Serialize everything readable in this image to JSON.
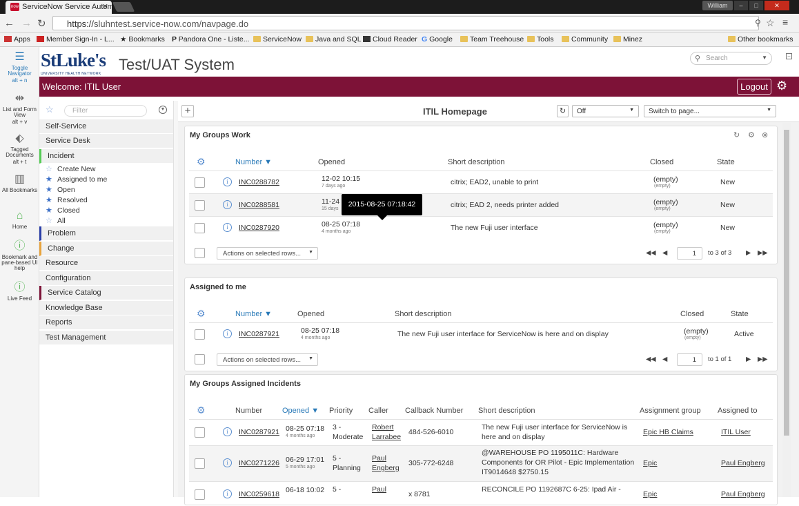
{
  "browser": {
    "tab_title": "ServiceNow Service Autom",
    "tab_favicon": "now",
    "user_badge": "William",
    "url_scheme": "https://",
    "url_rest": "sluhntest.service-now.com/navpage.do",
    "bookmarks": [
      "Apps",
      "Member Sign-In - L...",
      "Bookmarks",
      "Pandora One - Liste...",
      "ServiceNow",
      "Java and SQL",
      "Cloud Reader",
      "Google",
      "Team Treehouse",
      "Tools",
      "Community",
      "Minez"
    ],
    "other_bookmarks": "Other bookmarks"
  },
  "rail": {
    "items": [
      {
        "label": "Toggle Navigator",
        "shortcut": "alt + n"
      },
      {
        "label": "List and Form View",
        "shortcut": "alt + v"
      },
      {
        "label": "Tagged Documents",
        "shortcut": "alt + t"
      },
      {
        "label": "All Bookmarks",
        "shortcut": ""
      },
      {
        "label": "Home",
        "shortcut": ""
      },
      {
        "label": "Bookmark and pane-based UI help",
        "shortcut": ""
      },
      {
        "label": "Live Feed",
        "shortcut": ""
      }
    ]
  },
  "header": {
    "logo": "StLuke's",
    "logo_sub": "UNIVERSITY HEALTH NETWORK",
    "system_title": "Test/UAT System",
    "search_placeholder": "Search",
    "welcome": "Welcome:  ITIL User",
    "logout": "Logout"
  },
  "nav": {
    "filter_placeholder": "Filter",
    "modules": [
      "Self-Service",
      "Service Desk",
      "Incident",
      "Problem",
      "Change",
      "Resource",
      "Configuration",
      "Service Catalog",
      "Knowledge Base",
      "Reports",
      "Test Management"
    ],
    "incident_links": [
      "Create New",
      "Assigned to me",
      "Open",
      "Resolved",
      "Closed",
      "All"
    ]
  },
  "content": {
    "title": "ITIL Homepage",
    "off_select": "Off",
    "switch_page": "Switch to page...",
    "tooltip": "2015-08-25 07:18:42"
  },
  "panel1": {
    "title": "My Groups Work",
    "headers": [
      "Number ▼",
      "Opened",
      "Short description",
      "Closed",
      "State"
    ],
    "rows": [
      {
        "number": "INC0288782",
        "opened": "12-02 10:15",
        "ago": "7 days ago",
        "desc": "citrix; EAD2, unable to print",
        "closed": "(empty)",
        "closed_sub": "(empty)",
        "state": "New"
      },
      {
        "number": "INC0288581",
        "opened": "11-24",
        "ago": "15 days",
        "desc": "citrix; EAD 2, needs printer added",
        "closed": "(empty)",
        "closed_sub": "(empty)",
        "state": "New"
      },
      {
        "number": "INC0287920",
        "opened": "08-25 07:18",
        "ago": "4 months ago",
        "desc": "The new Fuji user interface",
        "closed": "(empty)",
        "closed_sub": "(empty)",
        "state": "New"
      }
    ],
    "actions": "Actions on selected rows...",
    "page": "1",
    "page_of": "to 3 of 3"
  },
  "panel2": {
    "title": "Assigned to me",
    "headers": [
      "Number ▼",
      "Opened",
      "Short description",
      "Closed",
      "State"
    ],
    "rows": [
      {
        "number": "INC0287921",
        "opened": "08-25 07:18",
        "ago": "4 months ago",
        "desc": "The new Fuji user interface for ServiceNow is here and on display",
        "closed": "(empty)",
        "closed_sub": "(empty)",
        "state": "Active"
      }
    ],
    "actions": "Actions on selected rows...",
    "page": "1",
    "page_of": "to 1 of 1"
  },
  "panel3": {
    "title": "My Groups Assigned Incidents",
    "headers": [
      "Number",
      "Opened ▼",
      "Priority",
      "Caller",
      "Callback Number",
      "Short description",
      "Assignment group",
      "Assigned to"
    ],
    "rows": [
      {
        "number": "INC0287921",
        "opened": "08-25 07:18",
        "ago": "4 months ago",
        "priority1": "3 -",
        "priority2": "Moderate",
        "caller1": "Robert",
        "caller2": "Larrabee",
        "callback": "484-526-6010",
        "desc1": "The new Fuji user interface for ServiceNow is",
        "desc2": "here and on display",
        "desc3": "",
        "group": "Epic HB Claims",
        "assigned": "ITIL User"
      },
      {
        "number": "INC0271226",
        "opened": "06-29 17:01",
        "ago": "5 months ago",
        "priority1": "5 -",
        "priority2": "Planning",
        "caller1": "Paul",
        "caller2": "Engberg",
        "callback": "305-772-6248",
        "desc1": "@WAREHOUSE PO 1195011C: Hardware",
        "desc2": "Components for OR Pilot - Epic Implementation",
        "desc3": "IT9014648 $2750.15",
        "group": "Epic",
        "assigned": "Paul Engberg"
      },
      {
        "number": "INC0259618",
        "opened": "06-18 10:02",
        "ago": "",
        "priority1": "5 -",
        "priority2": "",
        "caller1": "Paul",
        "caller2": "",
        "callback": "x 8781",
        "desc1": "RECONCILE PO 1192687C 6-25: Ipad Air -",
        "desc2": "",
        "desc3": "",
        "group": "Epic",
        "assigned": "Paul Engberg"
      }
    ]
  }
}
